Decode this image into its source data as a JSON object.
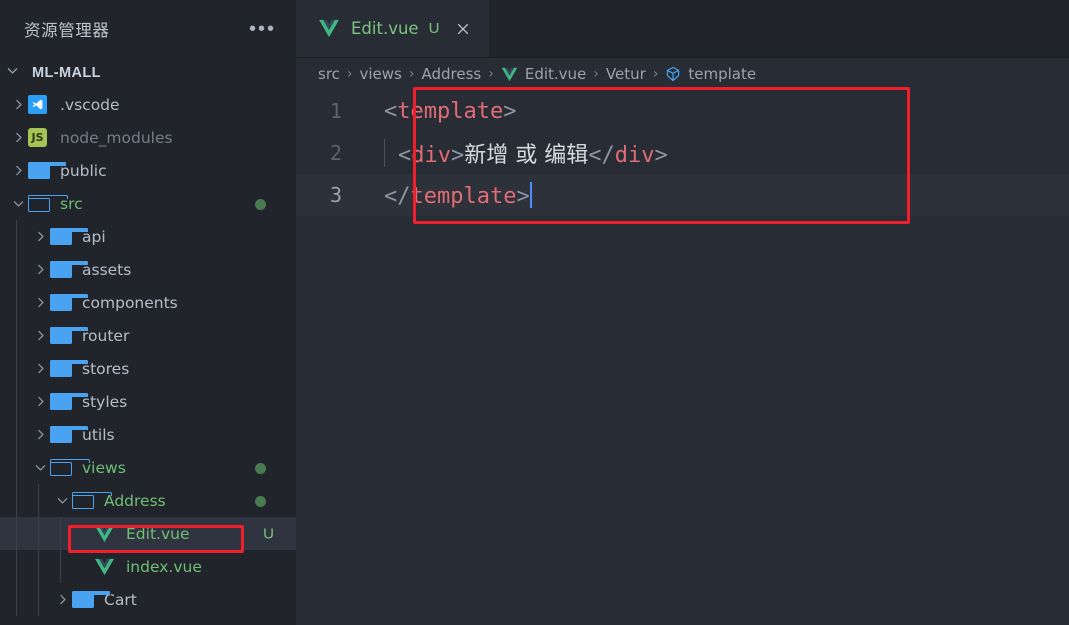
{
  "sidebar": {
    "title": "资源管理器",
    "more_actions_icon": "ellipsis-icon",
    "root": {
      "label": "ML-MALL",
      "expanded": true
    },
    "items": [
      {
        "label": ".vscode",
        "icon": "vscode-icon",
        "indent": 1,
        "twisty": "collapsed",
        "color": "default",
        "dot": false,
        "badge": ""
      },
      {
        "label": "node_modules",
        "icon": "node-icon",
        "indent": 1,
        "twisty": "collapsed",
        "color": "dim",
        "dot": false,
        "badge": ""
      },
      {
        "label": "public",
        "icon": "folder-icon",
        "indent": 1,
        "twisty": "collapsed",
        "color": "default",
        "dot": false,
        "badge": ""
      },
      {
        "label": "src",
        "icon": "folder-open-icon",
        "indent": 1,
        "twisty": "expanded",
        "color": "green",
        "dot": true,
        "badge": ""
      },
      {
        "label": "api",
        "icon": "folder-icon",
        "indent": 2,
        "twisty": "collapsed",
        "color": "default",
        "dot": false,
        "badge": ""
      },
      {
        "label": "assets",
        "icon": "folder-icon",
        "indent": 2,
        "twisty": "collapsed",
        "color": "default",
        "dot": false,
        "badge": ""
      },
      {
        "label": "components",
        "icon": "folder-icon",
        "indent": 2,
        "twisty": "collapsed",
        "color": "default",
        "dot": false,
        "badge": ""
      },
      {
        "label": "router",
        "icon": "folder-icon",
        "indent": 2,
        "twisty": "collapsed",
        "color": "default",
        "dot": false,
        "badge": ""
      },
      {
        "label": "stores",
        "icon": "folder-icon",
        "indent": 2,
        "twisty": "collapsed",
        "color": "default",
        "dot": false,
        "badge": ""
      },
      {
        "label": "styles",
        "icon": "folder-icon",
        "indent": 2,
        "twisty": "collapsed",
        "color": "default",
        "dot": false,
        "badge": ""
      },
      {
        "label": "utils",
        "icon": "folder-icon",
        "indent": 2,
        "twisty": "collapsed",
        "color": "default",
        "dot": false,
        "badge": ""
      },
      {
        "label": "views",
        "icon": "folder-open-icon",
        "indent": 2,
        "twisty": "expanded",
        "color": "green",
        "dot": true,
        "badge": ""
      },
      {
        "label": "Address",
        "icon": "folder-open-icon",
        "indent": 3,
        "twisty": "expanded",
        "color": "green",
        "dot": true,
        "badge": ""
      },
      {
        "label": "Edit.vue",
        "icon": "vue-icon",
        "indent": 4,
        "twisty": "none",
        "color": "green",
        "dot": false,
        "badge": "U",
        "selected": true,
        "highlighted": true
      },
      {
        "label": "index.vue",
        "icon": "vue-icon",
        "indent": 4,
        "twisty": "none",
        "color": "green",
        "dot": false,
        "badge": ""
      },
      {
        "label": "Cart",
        "icon": "folder-icon",
        "indent": 3,
        "twisty": "collapsed",
        "color": "default",
        "dot": false,
        "badge": ""
      }
    ]
  },
  "tabs": [
    {
      "label": "Edit.vue",
      "icon": "vue-icon",
      "status": "U",
      "close_icon": "close-icon",
      "active": true
    }
  ],
  "breadcrumb": [
    {
      "label": "src",
      "icon": ""
    },
    {
      "label": "views",
      "icon": ""
    },
    {
      "label": "Address",
      "icon": ""
    },
    {
      "label": "Edit.vue",
      "icon": "vue-icon"
    },
    {
      "label": "Vetur",
      "icon": ""
    },
    {
      "label": "template",
      "icon": "symbol-cube-icon"
    }
  ],
  "breadcrumb_separator": "›",
  "editor": {
    "lines": [
      {
        "number": "1",
        "active": false,
        "indent_guide": false,
        "tokens": [
          {
            "t": "<",
            "k": "punct"
          },
          {
            "t": "template",
            "k": "tag"
          },
          {
            "t": ">",
            "k": "punct"
          }
        ]
      },
      {
        "number": "2",
        "active": false,
        "indent_guide": true,
        "tokens": [
          {
            "t": "  ",
            "k": "text"
          },
          {
            "t": "<",
            "k": "punct"
          },
          {
            "t": "div",
            "k": "tag"
          },
          {
            "t": ">",
            "k": "punct"
          },
          {
            "t": "新增 或 编辑",
            "k": "text"
          },
          {
            "t": "</",
            "k": "punct"
          },
          {
            "t": "div",
            "k": "tag"
          },
          {
            "t": ">",
            "k": "punct"
          }
        ]
      },
      {
        "number": "3",
        "active": true,
        "indent_guide": false,
        "caret": true,
        "tokens": [
          {
            "t": "</",
            "k": "punct"
          },
          {
            "t": "template",
            "k": "tag"
          },
          {
            "t": ">",
            "k": "punct"
          }
        ]
      }
    ]
  },
  "annotations": [
    {
      "name": "editor-code-highlight",
      "color": "#f01f2b"
    },
    {
      "name": "sidebar-file-highlight",
      "color": "#f01f2b"
    }
  ],
  "colors": {
    "sidebar_bg": "#21252b",
    "editor_bg": "#282c34",
    "tabbar_bg": "#21252b",
    "active_line_bg": "#2c313a",
    "selection_bg": "#2f3440",
    "accent_green": "#7cc47f",
    "tag_red": "#e06c75",
    "punct_blue": "#8d96a5",
    "folder_blue": "#4aa3f0",
    "caret_blue": "#528bff",
    "annotation_red": "#f01f2b"
  }
}
